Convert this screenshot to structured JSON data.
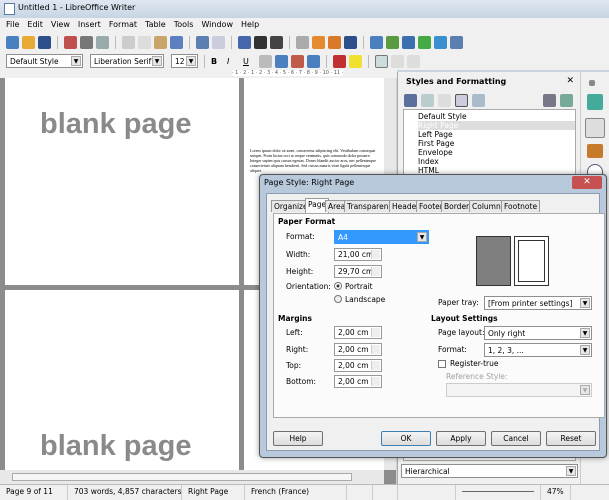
{
  "window": {
    "title": "Untitled 1 - LibreOffice Writer"
  },
  "menu": [
    "File",
    "Edit",
    "View",
    "Insert",
    "Format",
    "Table",
    "Tools",
    "Window",
    "Help"
  ],
  "format_bar": {
    "paragraph_style": "Default Style",
    "font_name": "Liberation Serif",
    "font_size": "12"
  },
  "ruler": {
    "marks": "· 1 · 2 · 1 · 2 · 3 · 4 · 5 · 6 · 7 · 8 · 9 · 10 · 11 ·"
  },
  "document": {
    "page_text_1": "blank page",
    "page_text_2": "blank page",
    "lorem": "Lorem ipsum dolor sit amet, consectetur adipiscing elit. Vestibulum consequat sempet. Proin luctus orci ac neque venenatis, quis commodo dolor posuere. Integer sapien quis cursus egestas. Donec blandit auctor arcu, nec pellentesque consectetuer aliquam hendrerit. Sed cursus mauris vitae ligula pellentesque aliquet."
  },
  "sidebar": {
    "title": "Styles and Formatting",
    "styles": [
      "Default Style",
      "Right Page",
      "Left Page",
      "First Page",
      "Envelope",
      "Index",
      "HTML"
    ],
    "selected": "Right Page",
    "filter": "Hierarchical"
  },
  "dialog": {
    "title": "Page Style: Right Page",
    "tabs": [
      "Organizer",
      "Page",
      "Area",
      "Transparency",
      "Header",
      "Footer",
      "Borders",
      "Columns",
      "Footnote"
    ],
    "active_tab": "Page",
    "paper_format": {
      "heading": "Paper Format",
      "format_label": "Format:",
      "format_value": "A4",
      "width_label": "Width:",
      "width_value": "21,00 cm",
      "height_label": "Height:",
      "height_value": "29,70 cm",
      "orientation_label": "Orientation:",
      "portrait": "Portrait",
      "landscape": "Landscape",
      "orientation_selected": "Portrait"
    },
    "paper_tray_label": "Paper tray:",
    "paper_tray_value": "[From printer settings]",
    "margins": {
      "heading": "Margins",
      "left_label": "Left:",
      "left": "2,00 cm",
      "right_label": "Right:",
      "right": "2,00 cm",
      "top_label": "Top:",
      "top": "2,00 cm",
      "bottom_label": "Bottom:",
      "bottom": "2,00 cm"
    },
    "layout": {
      "heading": "Layout Settings",
      "page_layout_label": "Page layout:",
      "page_layout": "Only right",
      "format_label": "Format:",
      "format": "1, 2, 3, ...",
      "register_true": "Register-true",
      "register_checked": false,
      "reference_style_label": "Reference Style:"
    },
    "buttons": {
      "help": "Help",
      "ok": "OK",
      "apply": "Apply",
      "cancel": "Cancel",
      "reset": "Reset"
    }
  },
  "status": {
    "page": "Page 9 of 11",
    "words": "703 words, 4,857 characters",
    "style": "Right Page",
    "language": "French (France)",
    "zoom": "47%"
  },
  "colors": {
    "selection": "#3399ff",
    "titlebar": "#c6d4e3"
  }
}
